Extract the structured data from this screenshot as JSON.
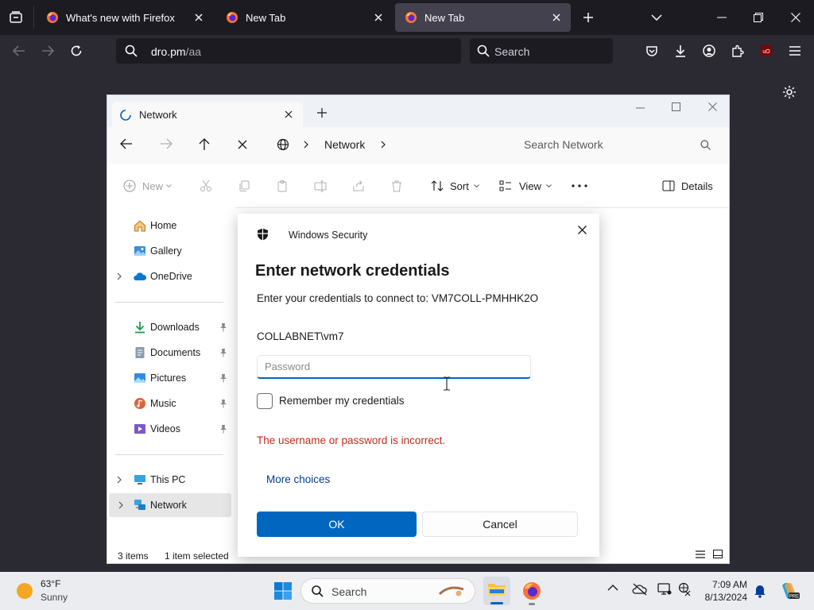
{
  "browser": {
    "tabs": [
      {
        "title": "What's new with Firefox",
        "active": false
      },
      {
        "title": "New Tab",
        "active": false
      },
      {
        "title": "New Tab",
        "active": true
      }
    ],
    "url_host": "dro.pm",
    "url_path": "/aa",
    "search_placeholder": "Search"
  },
  "explorer": {
    "tab_title": "Network",
    "breadcrumb": "Network",
    "search_placeholder": "Search Network",
    "commands": {
      "new": "New",
      "sort": "Sort",
      "view": "View",
      "details": "Details"
    },
    "nav": {
      "home": "Home",
      "gallery": "Gallery",
      "onedrive": "OneDrive",
      "downloads": "Downloads",
      "documents": "Documents",
      "pictures": "Pictures",
      "music": "Music",
      "videos": "Videos",
      "this_pc": "This PC",
      "network": "Network"
    },
    "status": {
      "items": "3 items",
      "selected": "1 item selected"
    }
  },
  "dialog": {
    "brand": "Windows Security",
    "title": "Enter network credentials",
    "subtitle": "Enter your credentials to connect to: VM7COLL-PMHHK2O",
    "username": "COLLABNET\\vm7",
    "password_placeholder": "Password",
    "remember_label": "Remember my credentials",
    "remember_checked": false,
    "error": "The username or password is incorrect.",
    "more_choices": "More choices",
    "ok": "OK",
    "cancel": "Cancel"
  },
  "taskbar": {
    "weather_temp": "63°F",
    "weather_condition": "Sunny",
    "search_placeholder": "Search",
    "time": "7:09 AM",
    "date": "8/13/2024"
  },
  "colors": {
    "firefox_dark": "#1c1b22",
    "accent_blue": "#0067c0",
    "error_red": "#c42b1c"
  }
}
